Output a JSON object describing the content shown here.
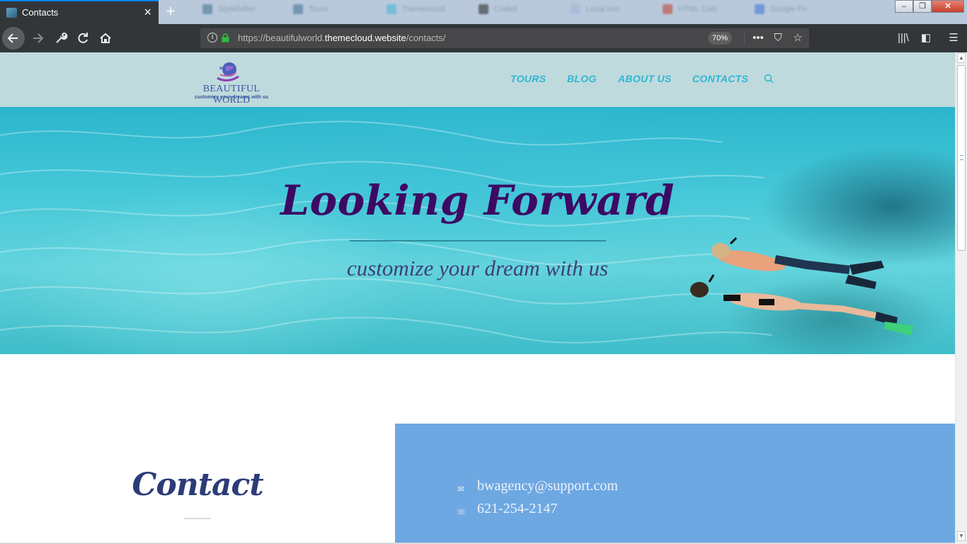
{
  "browser": {
    "active_tab": {
      "title": "Contacts",
      "close": "×"
    },
    "new_tab": "+",
    "background_tabs": [
      "StyleEditor",
      "Tours",
      "Themecloud",
      "Coded",
      "Local hos",
      "HTML Colo",
      "Google Fo"
    ],
    "window_controls": {
      "minimize": "–",
      "restore": "❐",
      "close": "✕"
    },
    "url": {
      "prefix": "https://beautifulworld.",
      "domain": "themecloud.website",
      "path": "/contacts/"
    },
    "zoom": "70%",
    "page_actions": {
      "more": "•••",
      "pocket": "⛉",
      "bookmark": "☆"
    },
    "toolbar_icons": {
      "library": "|||\\",
      "sidebar": "◧",
      "menu": "☰"
    }
  },
  "site": {
    "logo": {
      "name": "BEAUTIFUL WORLD",
      "tagline": "customize your dreams with us"
    },
    "menu": [
      {
        "label": "TOURS"
      },
      {
        "label": "BLOG"
      },
      {
        "label": "ABOUT US"
      },
      {
        "label": "CONTACTS"
      }
    ],
    "hero": {
      "title": "Looking Forward",
      "subtitle": "customize your dream with us"
    },
    "contact": {
      "title": "Contact",
      "email": "bwagency@support.com",
      "phone": "621-254-2147"
    }
  },
  "colors": {
    "accent_menu": "#2fb6d4",
    "header_bg": "#bfdadc",
    "hero_title": "#3d0a63",
    "contact_panel": "#6ea8e2"
  },
  "icons": [
    "back-icon",
    "forward-icon",
    "wrench-icon",
    "reload-icon",
    "home-icon",
    "info-icon",
    "lock-icon",
    "search-icon",
    "mail-icon",
    "phone-icon"
  ]
}
